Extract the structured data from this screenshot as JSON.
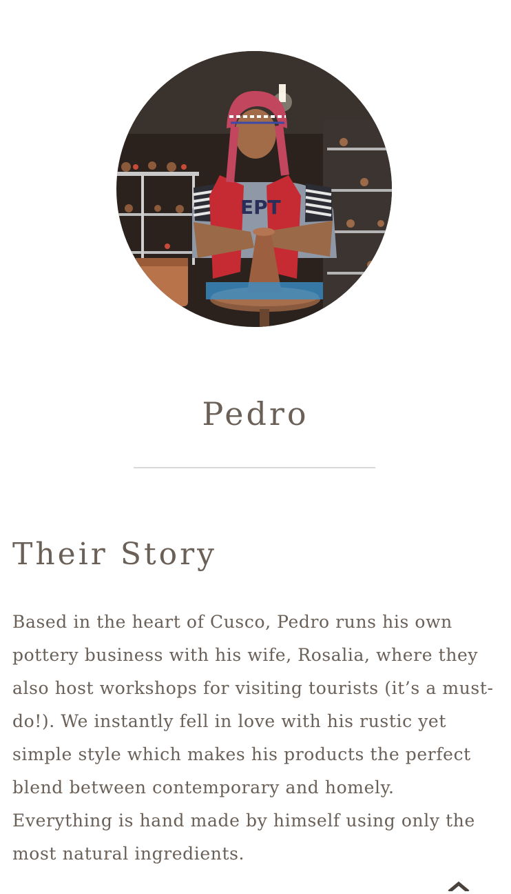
{
  "profile": {
    "name": "Pedro",
    "photo_icon": "portrait-photo-potter-at-wheel"
  },
  "story": {
    "heading": "Their Story",
    "body": "Based in the heart of Cusco, Pedro runs his own pottery business with his wife, Rosalia, where they also host workshops for visiting tourists (it’s a must-do!). We instantly fell in love with his rustic yet simple style which makes his products the perfect blend between contemporary and homely. Everything is hand made by himself using only the most natural ingredients."
  },
  "controls": {
    "back_to_top_icon": "chevron-up-icon"
  },
  "colors": {
    "text": "#6a6057",
    "divider": "#d8d8d8",
    "background": "#ffffff"
  }
}
